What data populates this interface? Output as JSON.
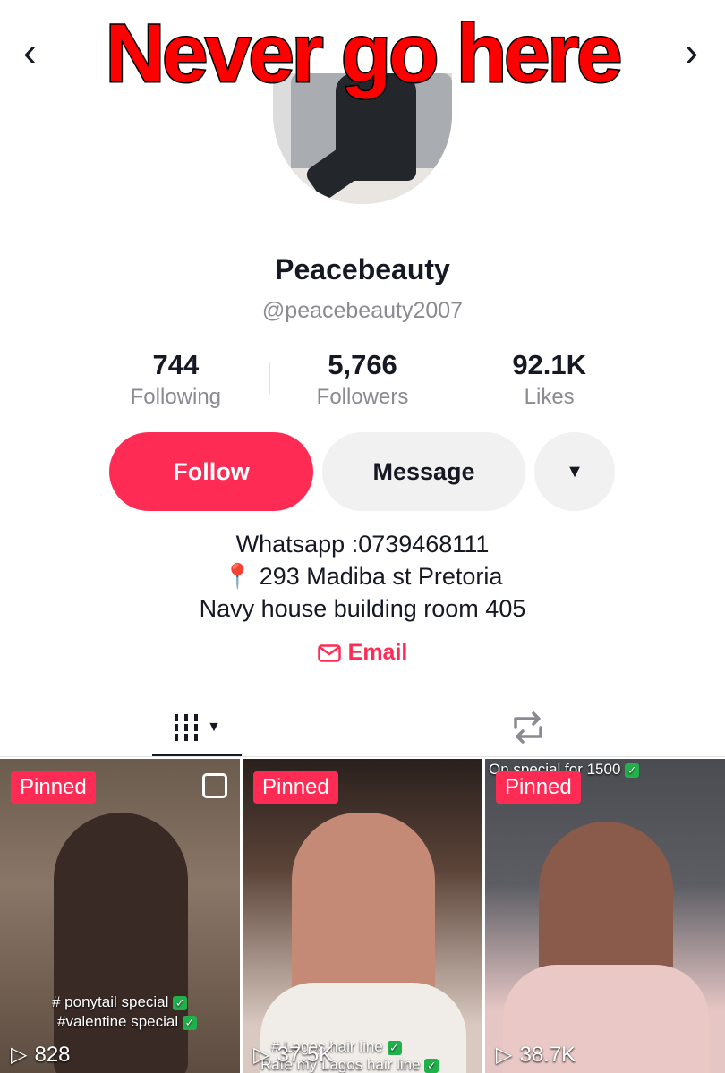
{
  "overlay": {
    "title": "Never go here"
  },
  "nav": {
    "back_icon": "chevron-left-icon",
    "share_icon": "share-icon"
  },
  "profile": {
    "name": "Peacebeauty",
    "handle": "@peacebeauty2007"
  },
  "stats": [
    {
      "value": "744",
      "label": "Following"
    },
    {
      "value": "5,766",
      "label": "Followers"
    },
    {
      "value": "92.1K",
      "label": "Likes"
    }
  ],
  "actions": {
    "follow_label": "Follow",
    "message_label": "Message"
  },
  "bio": {
    "line1": "Whatsapp :0739468111",
    "line2": "293 Madiba st Pretoria",
    "line3": "Navy house building room 405",
    "pin_emoji": "📍"
  },
  "email_link": {
    "label": "Email"
  },
  "videos": [
    {
      "pinned_label": "Pinned",
      "caption1": "# ponytail special",
      "caption2": "#valentine special",
      "views": "828"
    },
    {
      "pinned_label": "Pinned",
      "caption1": "# Lagos hair line",
      "caption2": "Rate my Lagos hair line",
      "views": "37.5K"
    },
    {
      "pinned_label": "Pinned",
      "caption1": "On special for 1500",
      "views": "38.7K"
    }
  ],
  "colors": {
    "brand_red": "#fe2c55",
    "overlay_red": "#ff0000",
    "muted_text": "#8a8b91",
    "button_gray": "#f1f1f2"
  }
}
